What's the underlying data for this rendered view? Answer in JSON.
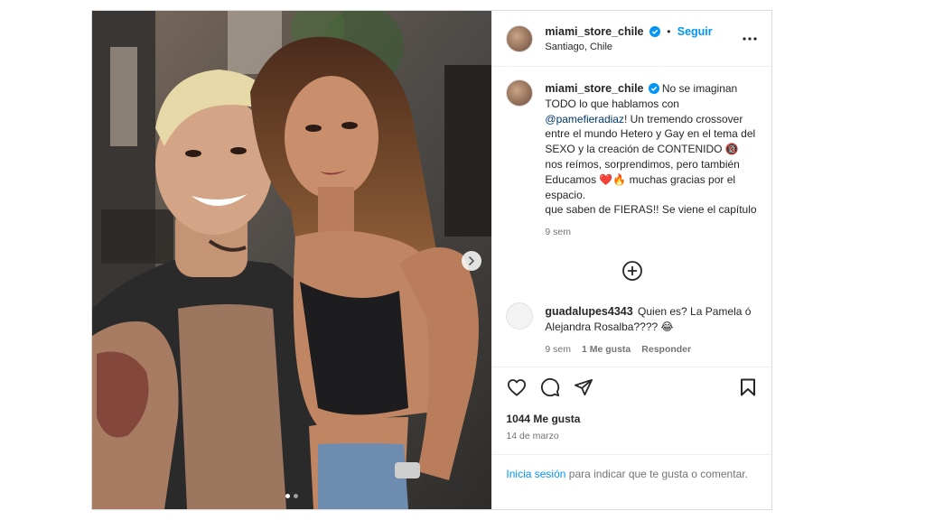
{
  "post": {
    "username": "miami_store_chile",
    "follow_label": "Seguir",
    "separator": "•",
    "location": "Santiago, Chile",
    "carousel": {
      "total_slides": 2,
      "active_slide": 1
    }
  },
  "caption": {
    "username": "miami_store_chile",
    "text_1": "No se imaginan TODO lo que hablamos con ",
    "mention": "@pamefieradiaz",
    "text_2": "! Un tremendo crossover entre el mundo Hetero y Gay en el tema del SEXO y la creación de CONTENIDO 🔞 nos reímos, sorprendimos, pero también Educamos ❤️🔥 muchas gracias por el espacio.",
    "text_3": "que saben de FIERAS!! Se viene el capítulo",
    "time": "9 sem"
  },
  "comments": [
    {
      "username": "guadalupes4343",
      "text": "Quien es? La Pamela ó Alejandra Rosalba???? 😂",
      "time": "9 sem",
      "likes": "1 Me gusta",
      "reply": "Responder"
    }
  ],
  "footer": {
    "likes": "1044 Me gusta",
    "date": "14 de marzo",
    "login_link": "Inicia sesión",
    "login_text": " para indicar que te gusta o comentar."
  },
  "colors": {
    "link": "#0095f6",
    "mention": "#00376b",
    "verified": "#0095f6",
    "muted": "#737373"
  },
  "icons": [
    "more-options-icon",
    "verified-badge-icon",
    "load-more-comments-icon",
    "heart-icon",
    "comment-icon",
    "share-icon",
    "bookmark-icon",
    "next-arrow-icon"
  ]
}
